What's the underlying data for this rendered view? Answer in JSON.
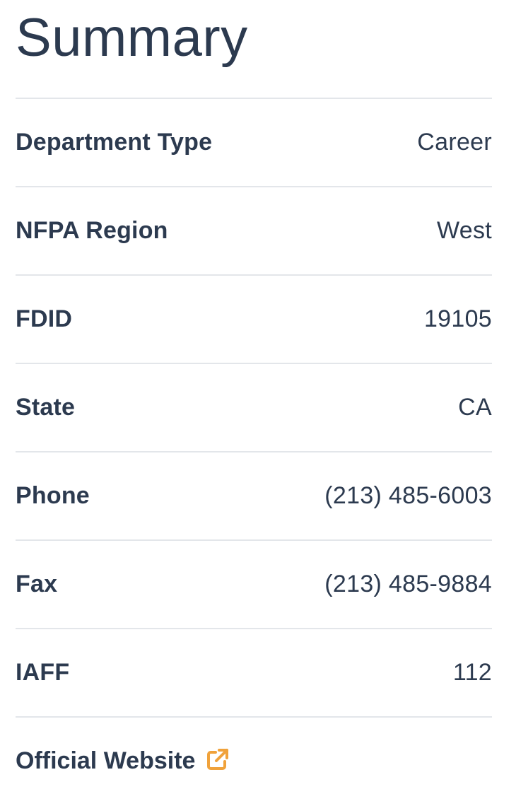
{
  "page": {
    "title": "Summary"
  },
  "rows": [
    {
      "label": "Department Type",
      "value": "Career"
    },
    {
      "label": "NFPA Region",
      "value": "West"
    },
    {
      "label": "FDID",
      "value": "19105"
    },
    {
      "label": "State",
      "value": "CA"
    },
    {
      "label": "Phone",
      "value": "(213) 485-6003"
    },
    {
      "label": "Fax",
      "value": "(213) 485-9884"
    },
    {
      "label": "IAFF",
      "value": "112"
    }
  ],
  "website": {
    "label": "Official Website",
    "icon": "external-link-icon",
    "icon_color": "#f0a23b"
  },
  "colors": {
    "text": "#2c3a4f",
    "divider": "#e3e6ea",
    "accent": "#f0a23b"
  }
}
